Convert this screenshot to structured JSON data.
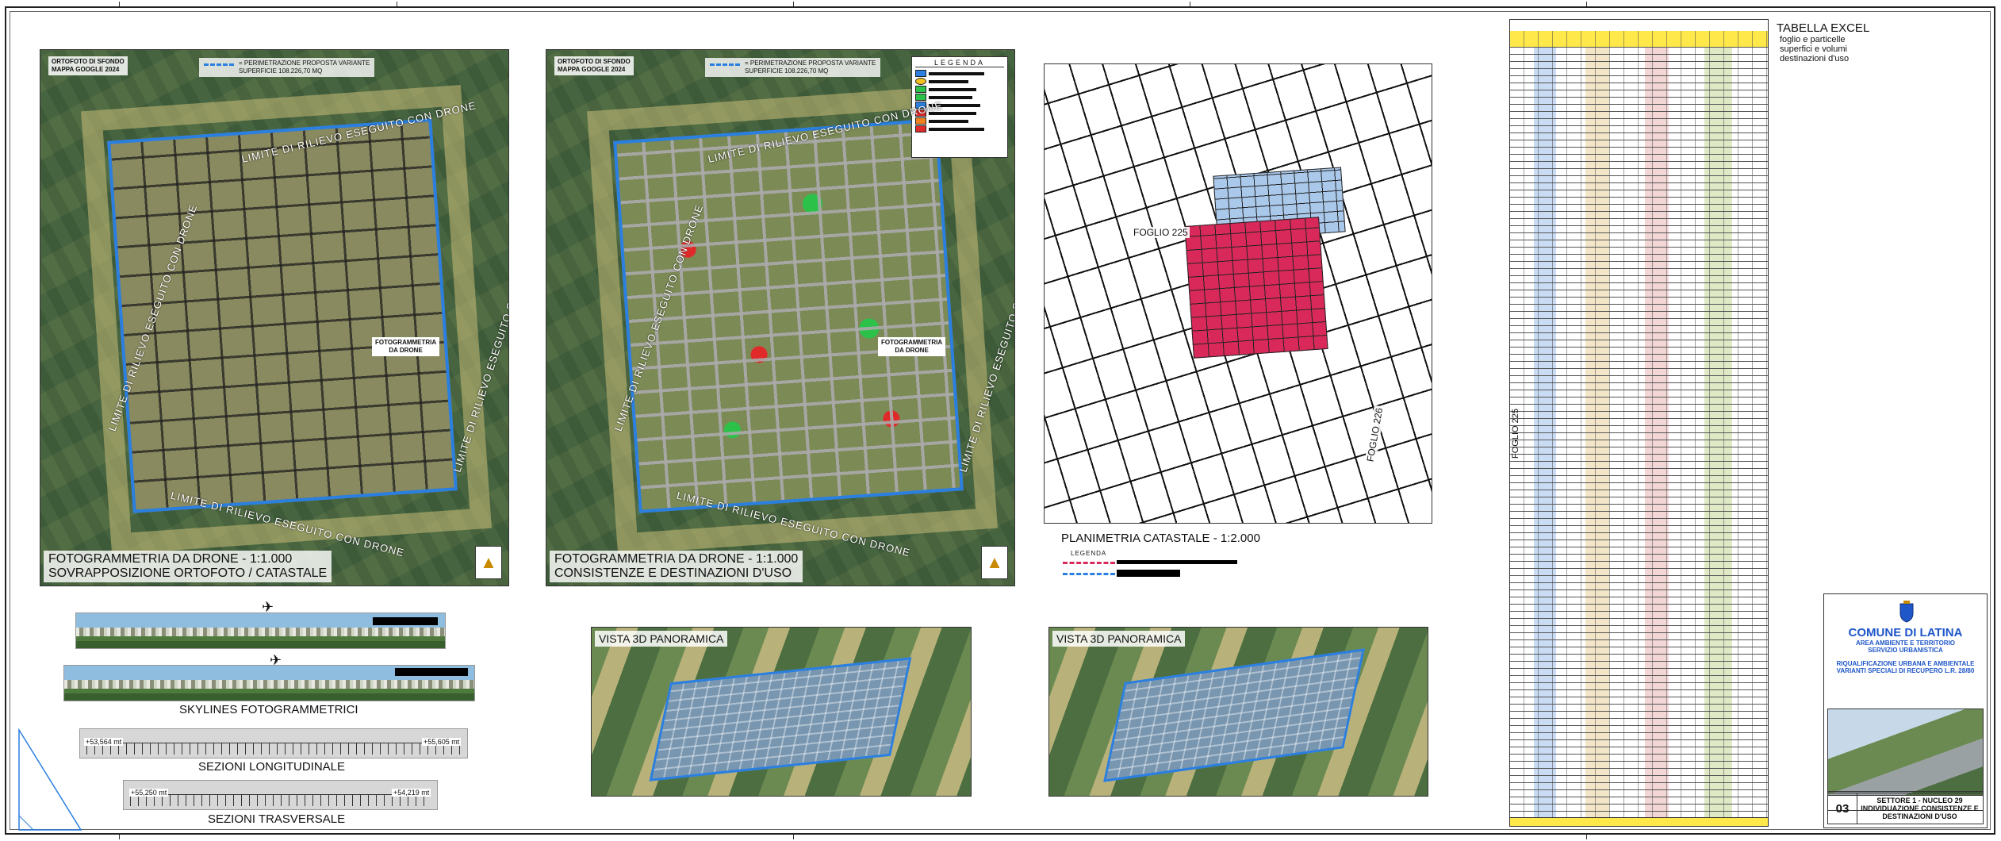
{
  "panels": {
    "ortho_catastale": {
      "sfondo_tag": "ORTOFOTO DI SFONDO\nMAPPA GOOGLE 2024",
      "perimeter_legend": "= PERIMETRAZIONE PROPOSTA VARIANTE\nSUPERFICIE 108.226,70 MQ",
      "rim_label": "LIMITE DI RILIEVO ESEGUITO CON DRONE",
      "foto_label": "FOTOGRAMMETRIA\nDA DRONE",
      "caption_line1": "FOTOGRAMMETRIA DA DRONE - 1:1.000",
      "caption_line2": "SOVRAPPOSIZIONE ORTOFOTO / CATASTALE"
    },
    "consistenze": {
      "sfondo_tag": "ORTOFOTO DI SFONDO\nMAPPA GOOGLE 2024",
      "perimeter_legend": "= PERIMETRAZIONE PROPOSTA VARIANTE\nSUPERFICIE 108.226,70 MQ",
      "rim_label": "LIMITE DI RILIEVO ESEGUITO CON DRONE",
      "foto_label": "FOTOGRAMMETRIA\nDA DRONE",
      "legend_title": "LEGENDA",
      "caption_line1": "FOTOGRAMMETRIA DA DRONE - 1:1.000",
      "caption_line2": "CONSISTENZE E DESTINAZIONI D'USO"
    },
    "catastale": {
      "foglio_left": "FOGLIO 225",
      "foglio_right": "FOGLIO 226",
      "title": "PLANIMETRIA CATASTALE - 1:2.000",
      "legend_title": "LEGENDA"
    }
  },
  "skylines": {
    "title": "SKYLINES FOTOGRAMMETRICI"
  },
  "sections": {
    "long_title": "SEZIONI LONGITUDINALE",
    "long_left": "+53,564 mt",
    "long_right": "+55,605 mt",
    "trans_title": "SEZIONI TRASVERSALE",
    "trans_left": "+55,250 mt",
    "trans_right": "+54,219 mt"
  },
  "vista": {
    "left": "VISTA 3D PANORAMICA",
    "right": "VISTA 3D PANORAMICA"
  },
  "excel": {
    "title": "TABELLA EXCEL",
    "line1": "foglio e particelle",
    "line2": "superfici e volumi",
    "line3": "destinazioni d'uso",
    "foglio_side": "FOGLIO 225"
  },
  "cartouche": {
    "city": "COMUNE DI LATINA",
    "dept1": "AREA AMBIENTE E TERRITORIO",
    "dept2": "SERVIZIO URBANISTICA",
    "proj1": "RIQUALIFICAZIONE URBANA E AMBIENTALE",
    "proj2": "VARIANTI SPECIALI DI RECUPERO L.R. 28/80",
    "sheet_no": "03",
    "sheet_title1": "SETTORE 1 - NUCLEO 29",
    "sheet_title2": "INDIVIDUAZIONE CONSISTENZE E",
    "sheet_title3": "DESTINAZIONI D'USO"
  },
  "colors": {
    "perimeter": "#2a7fe0",
    "residential": "#2cc24a",
    "other_use": "#e02a2a",
    "cadastral_highlight": "#d8295a",
    "cadastral_secondary": "#a9c8ea",
    "cartouche_blue": "#1f56c8"
  },
  "icons": {
    "north_arrow": "north-arrow-icon",
    "drone": "drone-icon",
    "coat_of_arms": "coat-of-arms-icon"
  }
}
